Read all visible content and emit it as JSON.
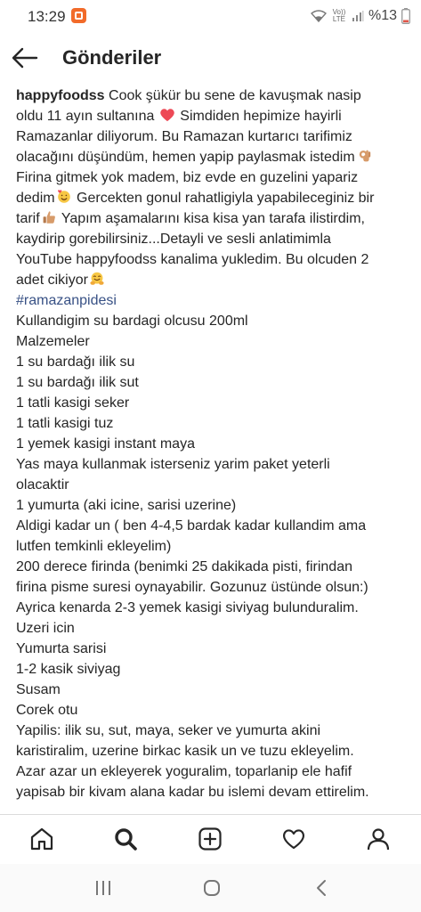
{
  "status_bar": {
    "time": "13:29",
    "network_label": "Vo)) LTE",
    "battery": "%13"
  },
  "header": {
    "title": "Gönderiler"
  },
  "post": {
    "username": "happyfoodss",
    "lines": [
      {
        "id": "l0",
        "text": " Cook şükür bu sene de kavuşmak nasip"
      },
      {
        "id": "l1",
        "text": "oldu 11 ayın sultanına",
        "emoji": "heart-icon"
      },
      {
        "id": "l1b",
        "text": " Simdiden hepimize hayirli"
      },
      {
        "id": "l2",
        "text": "Ramazanlar diliyorum. Bu Ramazan kurtarıcı tarifimiz"
      },
      {
        "id": "l3",
        "text": "olacağını düşündüm, hemen yapip paylasmak istedim"
      },
      {
        "id": "l4",
        "text": "Firina gitmek yok madem, biz evde en guzelini yapariz"
      },
      {
        "id": "l5",
        "text": "dedim"
      },
      {
        "id": "l5b",
        "text": " Gercekten gonul rahatligiyla yapabileceginiz bir"
      },
      {
        "id": "l6",
        "text": "tarif"
      },
      {
        "id": "l6b",
        "text": " Yapım aşamalarını kisa kisa yan tarafa ilistirdim,"
      },
      {
        "id": "l7",
        "text": "kaydirip gorebilirsiniz...Detayli ve sesli anlatimimla"
      },
      {
        "id": "l8",
        "text": "YouTube happyfoodss kanalima yukledim. Bu olcuden 2"
      },
      {
        "id": "l9",
        "text": "adet cikiyor"
      }
    ],
    "hashtag": "#ramazanpidesi",
    "recipe_lines": [
      "Kullandigim su bardagi olcusu 200ml",
      "Malzemeler",
      "1 su bardağı ilik su",
      "1 su bardağı ilik sut",
      "1 tatli kasigi seker",
      "1 tatli kasigi tuz",
      "1 yemek kasigi instant maya",
      "Yas maya kullanmak isterseniz yarim paket yeterli",
      "olacaktir",
      "1 yumurta (aki icine, sarisi uzerine)",
      "Aldigi kadar un ( ben 4-4,5 bardak kadar kullandim ama",
      "lutfen temkinli ekleyelim)",
      "200 derece firinda (benimki 25 dakikada pisti, firindan",
      "firina pisme suresi oynayabilir. Gozunuz üstünde olsun:)",
      "Ayrica kenarda 2-3 yemek kasigi siviyag bulunduralim.",
      "Uzeri icin",
      "Yumurta sarisi",
      "1-2 kasik siviyag",
      "Susam",
      "Corek otu",
      "Yapilis: ilik su, sut, maya, seker ve yumurta akini",
      "karistiralim, uzerine birkac kasik un ve tuzu ekleyelim.",
      "Azar azar un ekleyerek yoguralim, toparlanip ele hafif",
      "yapisab bir kivam alana kadar bu islemi devam ettirelim."
    ]
  },
  "bottom_nav": {
    "items": [
      "home-icon",
      "search-icon",
      "add-post-icon",
      "activity-heart-icon",
      "profile-icon"
    ]
  },
  "system_nav": {
    "items": [
      "recent-apps-icon",
      "home-circle-icon",
      "back-chevron-icon"
    ]
  },
  "colors": {
    "text": "#262626",
    "hashtag": "#385185",
    "heart": "#ed4956",
    "emoji_yellow": "#f7c744",
    "skin": "#d79b6a",
    "divider": "#dbdbdb"
  }
}
